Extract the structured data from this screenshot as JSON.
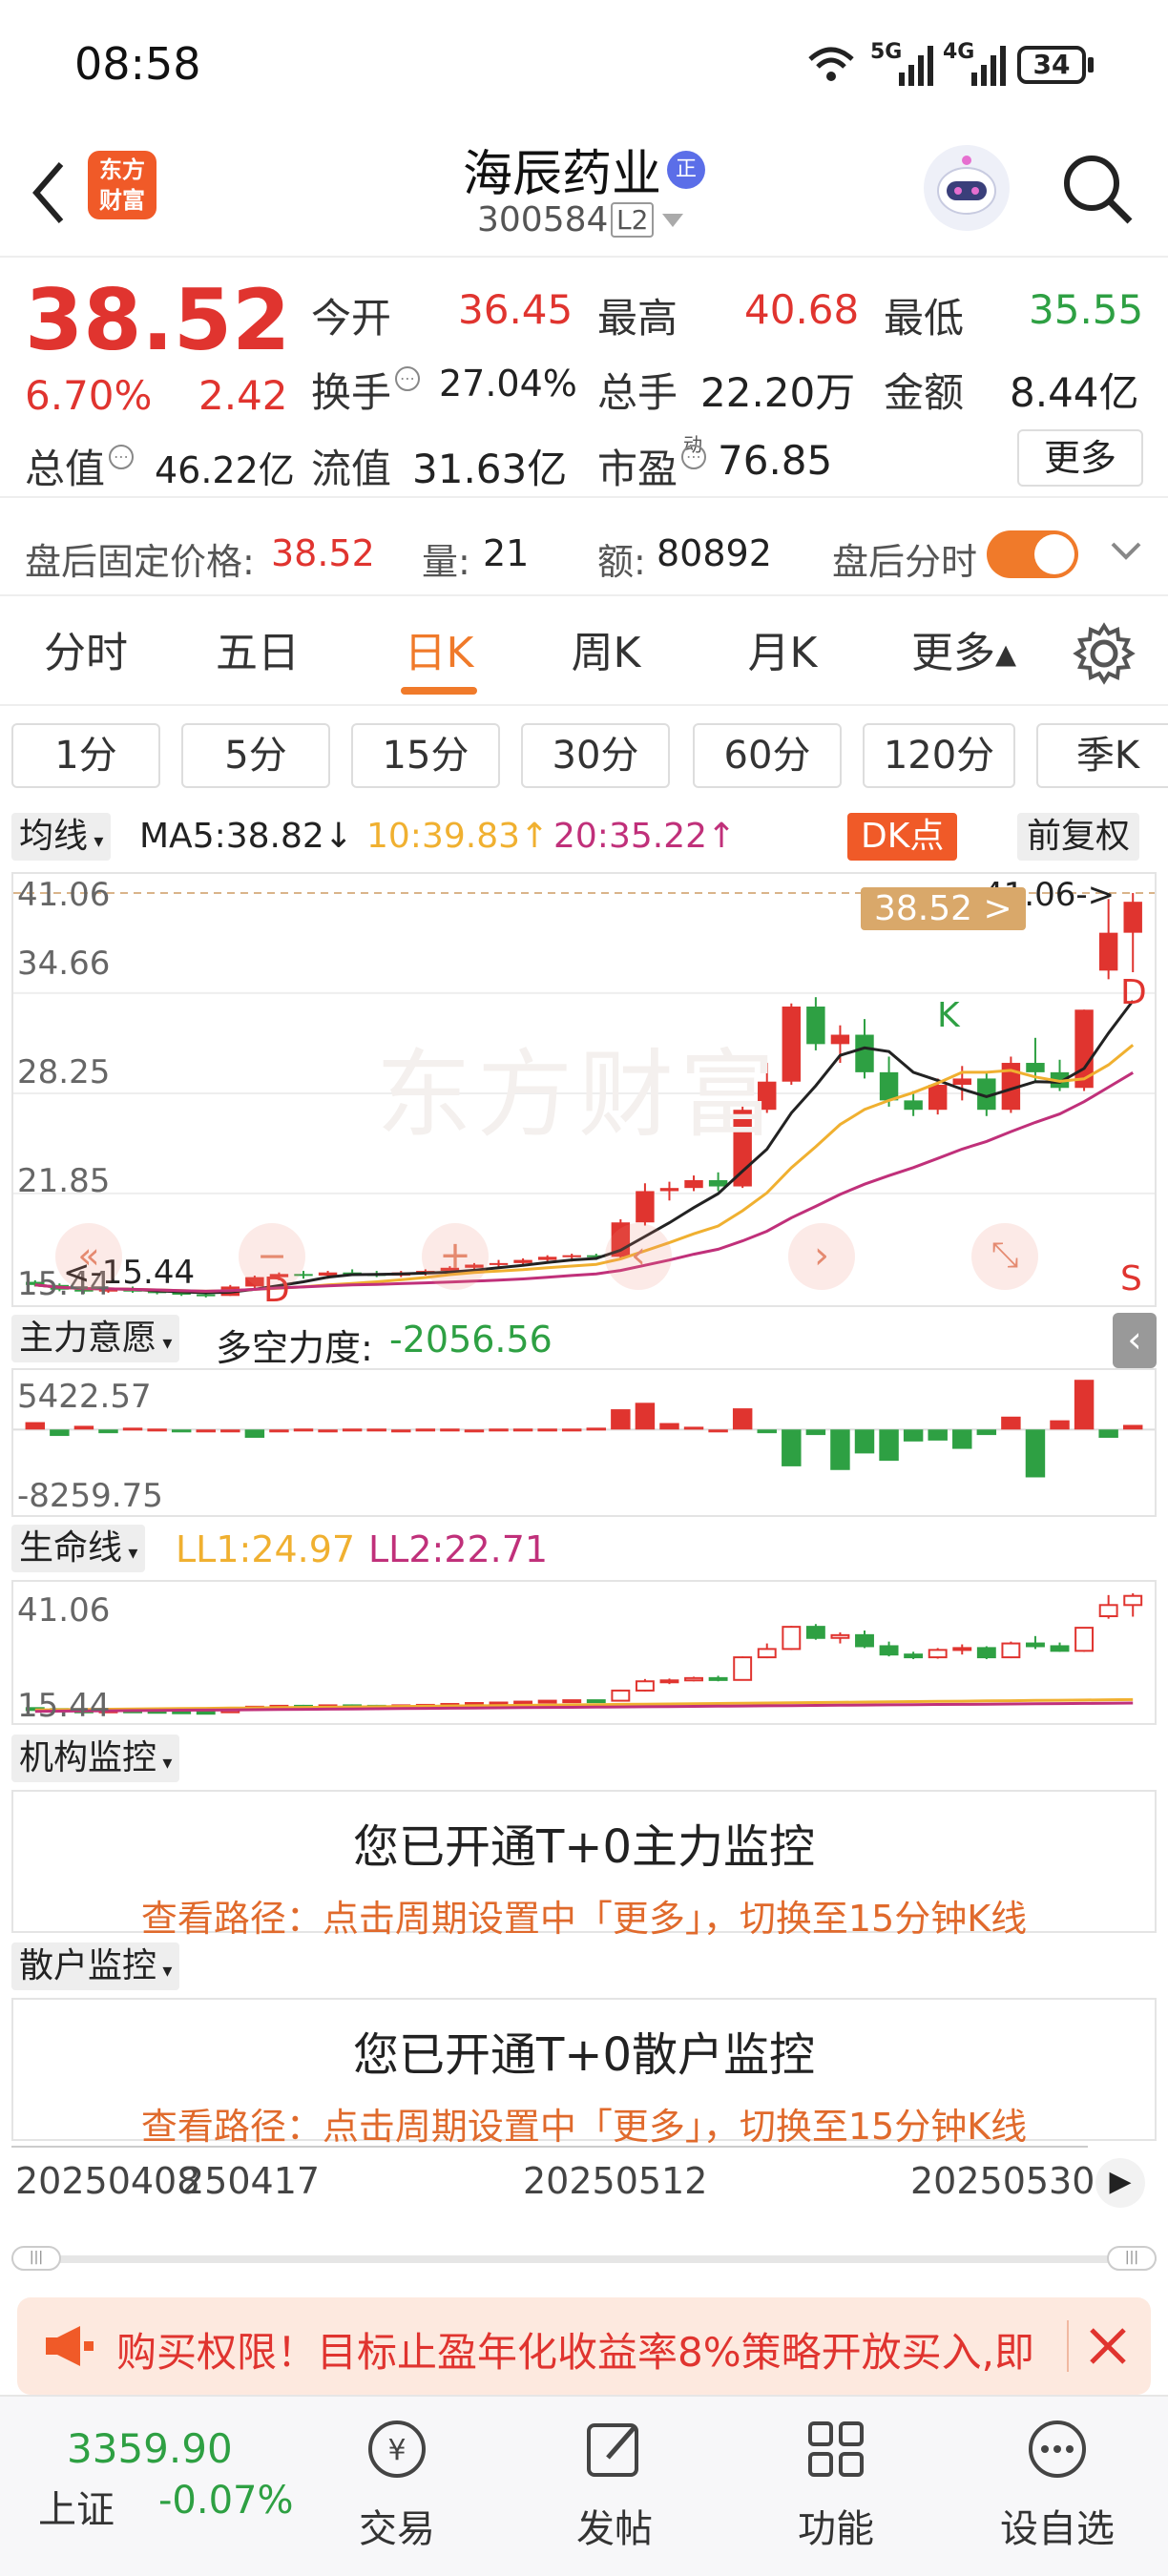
{
  "status_bar": {
    "time": "08:58",
    "battery": "34",
    "net1": "5G",
    "net2": "4G"
  },
  "nav": {
    "title": "海辰药业",
    "badge": "正",
    "code": "300584",
    "level": "L2",
    "logo_line1": "东方",
    "logo_line2": "财富"
  },
  "quote": {
    "price": "38.52",
    "change_pct": "6.70%",
    "change_amt": "2.42",
    "open_label": "今开",
    "open": "36.45",
    "high_label": "最高",
    "high": "40.68",
    "low_label": "最低",
    "low": "35.55",
    "turnover_label": "换手",
    "turnover": "27.04%",
    "volume_label": "总手",
    "volume": "22.20万",
    "amount_label": "金额",
    "amount": "8.44亿",
    "mktcap_label": "总值",
    "mktcap": "46.22亿",
    "float_label": "流值",
    "float": "31.63亿",
    "pe_label": "市盈",
    "pe_sup": "动",
    "pe": "76.85",
    "more_button": "更多"
  },
  "after_hours": {
    "label": "盘后固定价格:",
    "price": "38.52",
    "vol_label": "量:",
    "vol": "21",
    "amt_label": "额:",
    "amt": "80892",
    "switch_label": "盘后分时"
  },
  "tabs": [
    "分时",
    "五日",
    "日K",
    "周K",
    "月K",
    "更多▴"
  ],
  "active_tab": 2,
  "periods": [
    "1分",
    "5分",
    "15分",
    "30分",
    "60分",
    "120分",
    "季K"
  ],
  "ma_bar": {
    "selector": "均线",
    "ma5": "MA5:38.82↓",
    "ma10": "10:39.83↑",
    "ma20": "20:35.22↑",
    "dk_button": "DK点",
    "adj_button": "前复权"
  },
  "kchart": {
    "y_labels": [
      "41.06",
      "34.66",
      "28.25",
      "21.85",
      "15.44"
    ],
    "max_tag": "41.06->",
    "min_tag": "<-15.44",
    "price_tag": "38.52 >",
    "watermark": "东方财富",
    "markers": {
      "k": "K",
      "d1": "D",
      "d2": "D",
      "s": "S"
    }
  },
  "indicator1": {
    "selector": "主力意愿",
    "title": "多空力度:",
    "value": "-2056.56",
    "y_top": "5422.57",
    "y_bottom": "-8259.75"
  },
  "indicator2": {
    "selector": "生命线",
    "ll1": "LL1:24.97",
    "ll2": "LL2:22.71",
    "y_top": "41.06",
    "y_bottom": "15.44"
  },
  "monitor1": {
    "selector": "机构监控",
    "title": "您已开通T+0主力监控",
    "sub": "查看路径：点击周期设置中「更多」，切换至15分钟K线"
  },
  "monitor2": {
    "selector": "散户监控",
    "title": "您已开通T+0散户监控",
    "sub": "查看路径：点击周期设置中「更多」，切换至15分钟K线"
  },
  "dates": [
    "20250408",
    "250417",
    "20250512",
    "20250530"
  ],
  "banner": {
    "text": "购买权限！目标止盈年化收益率8%策略开放买入,即"
  },
  "bottom_nav": {
    "index_value": "3359.90",
    "index_name": "上证",
    "index_change": "-0.07%",
    "items": [
      "交易",
      "发帖",
      "功能",
      "设自选"
    ]
  },
  "colors": {
    "up": "#e0342f",
    "down": "#2ea043",
    "accent": "#f07a2a",
    "ma5": "#222222",
    "ma10": "#f0b030",
    "ma20": "#c0307a"
  },
  "chart_data": {
    "type": "candlestick",
    "ylim": [
      15.44,
      41.06
    ],
    "candles": [
      [
        16.2,
        16.3,
        15.9,
        16.0
      ],
      [
        16.0,
        16.1,
        15.6,
        15.7
      ],
      [
        15.7,
        15.9,
        15.44,
        15.6
      ],
      [
        15.6,
        15.8,
        15.5,
        15.7
      ],
      [
        15.7,
        15.9,
        15.5,
        15.6
      ],
      [
        15.6,
        15.7,
        15.4,
        15.5
      ],
      [
        15.5,
        15.6,
        15.3,
        15.4
      ],
      [
        15.4,
        15.5,
        15.2,
        15.3
      ],
      [
        15.3,
        16.0,
        15.3,
        15.9
      ],
      [
        15.9,
        16.6,
        15.8,
        16.5
      ],
      [
        16.5,
        16.8,
        16.3,
        16.7
      ],
      [
        16.7,
        16.9,
        16.4,
        16.6
      ],
      [
        16.6,
        16.9,
        16.4,
        16.8
      ],
      [
        16.8,
        17.0,
        16.6,
        16.7
      ],
      [
        16.7,
        16.9,
        16.5,
        16.6
      ],
      [
        16.6,
        16.9,
        16.5,
        16.8
      ],
      [
        16.8,
        17.0,
        16.6,
        16.9
      ],
      [
        16.9,
        17.2,
        16.8,
        17.1
      ],
      [
        17.1,
        17.4,
        16.9,
        17.3
      ],
      [
        17.3,
        17.6,
        17.1,
        17.4
      ],
      [
        17.4,
        17.7,
        17.2,
        17.6
      ],
      [
        17.6,
        17.9,
        17.4,
        17.8
      ],
      [
        17.8,
        18.0,
        17.5,
        17.9
      ],
      [
        17.9,
        18.0,
        17.6,
        17.8
      ],
      [
        17.8,
        20.2,
        17.7,
        20.0
      ],
      [
        20.0,
        22.5,
        19.8,
        22.0
      ],
      [
        22.0,
        22.6,
        21.4,
        22.2
      ],
      [
        22.2,
        23.0,
        22.0,
        22.7
      ],
      [
        22.7,
        23.2,
        22.0,
        22.3
      ],
      [
        22.3,
        27.4,
        22.2,
        27.2
      ],
      [
        27.2,
        30.2,
        27.0,
        29.0
      ],
      [
        29.0,
        34.0,
        28.8,
        33.8
      ],
      [
        33.8,
        34.4,
        31.0,
        31.4
      ],
      [
        31.4,
        32.6,
        30.2,
        32.0
      ],
      [
        32.0,
        33.0,
        29.2,
        29.6
      ],
      [
        29.6,
        30.6,
        27.4,
        27.8
      ],
      [
        27.8,
        28.4,
        26.8,
        27.2
      ],
      [
        27.2,
        29.2,
        26.9,
        28.8
      ],
      [
        28.8,
        30.0,
        27.8,
        29.2
      ],
      [
        29.2,
        29.6,
        26.8,
        27.2
      ],
      [
        27.2,
        30.6,
        27.0,
        30.2
      ],
      [
        30.2,
        31.8,
        29.0,
        29.6
      ],
      [
        29.6,
        30.4,
        28.4,
        28.6
      ],
      [
        28.6,
        33.6,
        28.4,
        33.6
      ],
      [
        36.1,
        40.68,
        35.55,
        38.52
      ],
      [
        38.52,
        41.06,
        36.0,
        40.5
      ]
    ],
    "osc": [
      0.8,
      -0.7,
      0.4,
      -0.4,
      0.2,
      0.1,
      -0.1,
      0.0,
      0.0,
      -0.9,
      0.0,
      0.1,
      0.0,
      0.1,
      0.1,
      0.0,
      0.1,
      0.1,
      0.0,
      0.1,
      0.1,
      0.1,
      0.1,
      0.2,
      2.2,
      2.9,
      0.7,
      0.3,
      0.0,
      2.3,
      -0.4,
      -4.0,
      -0.6,
      -4.4,
      -2.6,
      -3.4,
      -1.3,
      -1.2,
      -2.1,
      -0.6,
      1.4,
      -5.2,
      1.0,
      5.4,
      -0.9,
      0.5
    ],
    "osc_ylim": [
      -8259.75,
      5422.57
    ]
  }
}
